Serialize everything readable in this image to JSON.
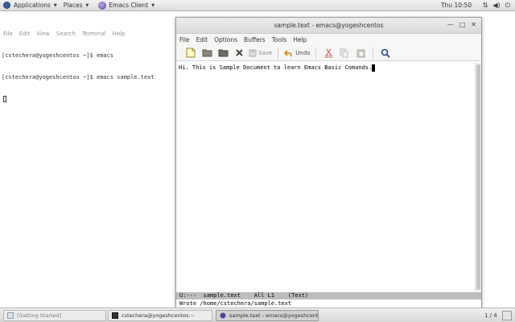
{
  "top_panel": {
    "applications": "Applications",
    "places": "Places",
    "app_name": "Emacs Client",
    "clock": "Thu 10:50",
    "status_icons": [
      "network-icon",
      "volume-icon",
      "power-icon"
    ]
  },
  "terminal": {
    "menu": [
      "File",
      "Edit",
      "View",
      "Search",
      "Terminal",
      "Help"
    ],
    "lines": [
      "[cstechera@yogeshcentos ~]$ emacs",
      "[cstechera@yogeshcentos ~]$ emacs sample.text"
    ]
  },
  "emacs": {
    "title": "sample.text - emacs@yogeshcentos",
    "menu": [
      "File",
      "Edit",
      "Options",
      "Buffers",
      "Tools",
      "Help"
    ],
    "toolbar": {
      "save_label": "Save",
      "undo_label": "Undo"
    },
    "buffer_text": "Hi. This is Sample Document to learn Emacs Basic Comands.",
    "mode_line": "U:---  sample.text    All L1    (Text)",
    "echo_area": "Wrote /home/cstechera/sample.text"
  },
  "taskbar": {
    "tasks": [
      {
        "label": "[Getting Started]"
      },
      {
        "label": "cstechera@yogeshcentos:~"
      },
      {
        "label": "sample.text - emacs@yogeshcent..."
      }
    ],
    "workspace": "1 / 4"
  },
  "colors": {
    "emacs_icon": "#5a3d9a",
    "mode_line_bg": "#bdbdbd"
  }
}
